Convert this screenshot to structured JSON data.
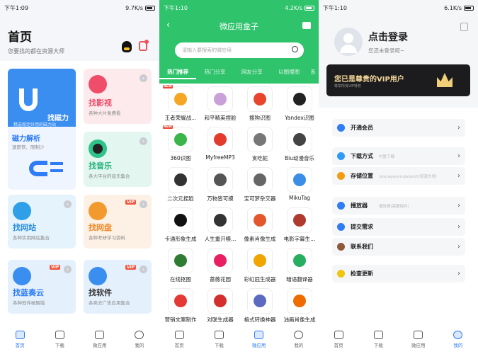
{
  "p1": {
    "status": {
      "time": "下午1:09",
      "speed": "9.7K/s",
      "battery": "79"
    },
    "title": "首页",
    "subtitle": "您要找的都在资源大师",
    "cards": [
      {
        "title": "找磁力",
        "sub": "精选稳定好用的磁力站"
      },
      {
        "title": "磁力解析",
        "sub": "速度快、限制少"
      },
      {
        "title": "找影视",
        "sub": "各种大片免费看"
      },
      {
        "title": "找音乐",
        "sub": "各大平台的音乐集合"
      },
      {
        "title": "找网站",
        "sub": "各种实用网站集合"
      },
      {
        "title": "找网盘",
        "sub": "各种考研学习资料",
        "badge": "VIP"
      },
      {
        "title": "找蓝奏云",
        "sub": "各种软件破解版",
        "badge": "VIP"
      },
      {
        "title": "找软件",
        "sub": "各类去广告应用集合",
        "badge": "VIP"
      }
    ],
    "nav": [
      "首页",
      "下载",
      "微应用",
      "我的"
    ]
  },
  "p2": {
    "status": {
      "time": "下午1:10",
      "speed": "4.2K/s",
      "battery": "79"
    },
    "title": "微应用盒子",
    "search_placeholder": "请输入要搜索的微应用",
    "tabs": [
      "热门推荐",
      "热门分享",
      "网友分享",
      "以图搜图",
      "系"
    ],
    "apps": [
      {
        "label": "王者荣耀战...",
        "color": "#f5a623",
        "new": true
      },
      {
        "label": "和平精英捏脸",
        "color": "#c9a0d8"
      },
      {
        "label": "搜狗识图",
        "color": "#e8452f"
      },
      {
        "label": "Yandex识图",
        "color": "#222222"
      },
      {
        "label": "360识图",
        "color": "#3bb54a",
        "new": true
      },
      {
        "label": "MyfreeMP3",
        "color": "#e33b2e"
      },
      {
        "label": "贪吃蛇",
        "color": "#777777"
      },
      {
        "label": "Biu动漫音乐",
        "color": "#444444"
      },
      {
        "label": "二次元捏脸",
        "color": "#333333"
      },
      {
        "label": "万物皆可摸",
        "color": "#555555"
      },
      {
        "label": "宝可梦杂交器",
        "color": "#666666"
      },
      {
        "label": "MikuTag",
        "color": "#3a8ee6"
      },
      {
        "label": "卡通形象生成",
        "color": "#111111"
      },
      {
        "label": "人生重开模...",
        "color": "#333333"
      },
      {
        "label": "像素肖像生成",
        "color": "#e4572e"
      },
      {
        "label": "电影字幕生...",
        "color": "#b03a2e"
      },
      {
        "label": "在线抠图",
        "color": "#2e7d32"
      },
      {
        "label": "蔷薇花园",
        "color": "#e91e63"
      },
      {
        "label": "彩虹屁生成器",
        "color": "#f0a500"
      },
      {
        "label": "暗语翻译器",
        "color": "#27ae60"
      },
      {
        "label": "营销文案制作",
        "color": "#e53935"
      },
      {
        "label": "对联生成器",
        "color": "#d32f2f"
      },
      {
        "label": "格式转换神器",
        "color": "#5c6bc0"
      },
      {
        "label": "油画肖像生成",
        "color": "#ef6c00"
      }
    ],
    "nav": [
      "首页",
      "下载",
      "微应用",
      "我的"
    ]
  },
  "p3": {
    "status": {
      "time": "下午1:10",
      "speed": "6.1K/s",
      "battery": "79"
    },
    "login": "点击登录",
    "unlogged": "您还未登录呢~",
    "vip_title": "您已是尊贵的VIP用户",
    "vip_sub": "尊享所有VIP特权",
    "menu": [
      {
        "label": "开通会员",
        "value": "",
        "color": "#2f7cf6"
      },
      {
        "label": "下载方式",
        "value": "内置下载",
        "color": "#2f9bf6"
      },
      {
        "label": "存储位置",
        "value": "/storage/emulated/0/资源大师/",
        "color": "#f39c12"
      },
      {
        "label": "播放器",
        "value": "播放器(需要插件)",
        "color": "#2f7cf6"
      },
      {
        "label": "提交需求",
        "value": "",
        "color": "#2f7cf6"
      },
      {
        "label": "联系我们",
        "value": "",
        "color": "#8e5a3a"
      },
      {
        "label": "检查更新",
        "value": "",
        "color": "#f1c40f"
      }
    ],
    "nav": [
      "首页",
      "下载",
      "微应用",
      "我的"
    ]
  }
}
